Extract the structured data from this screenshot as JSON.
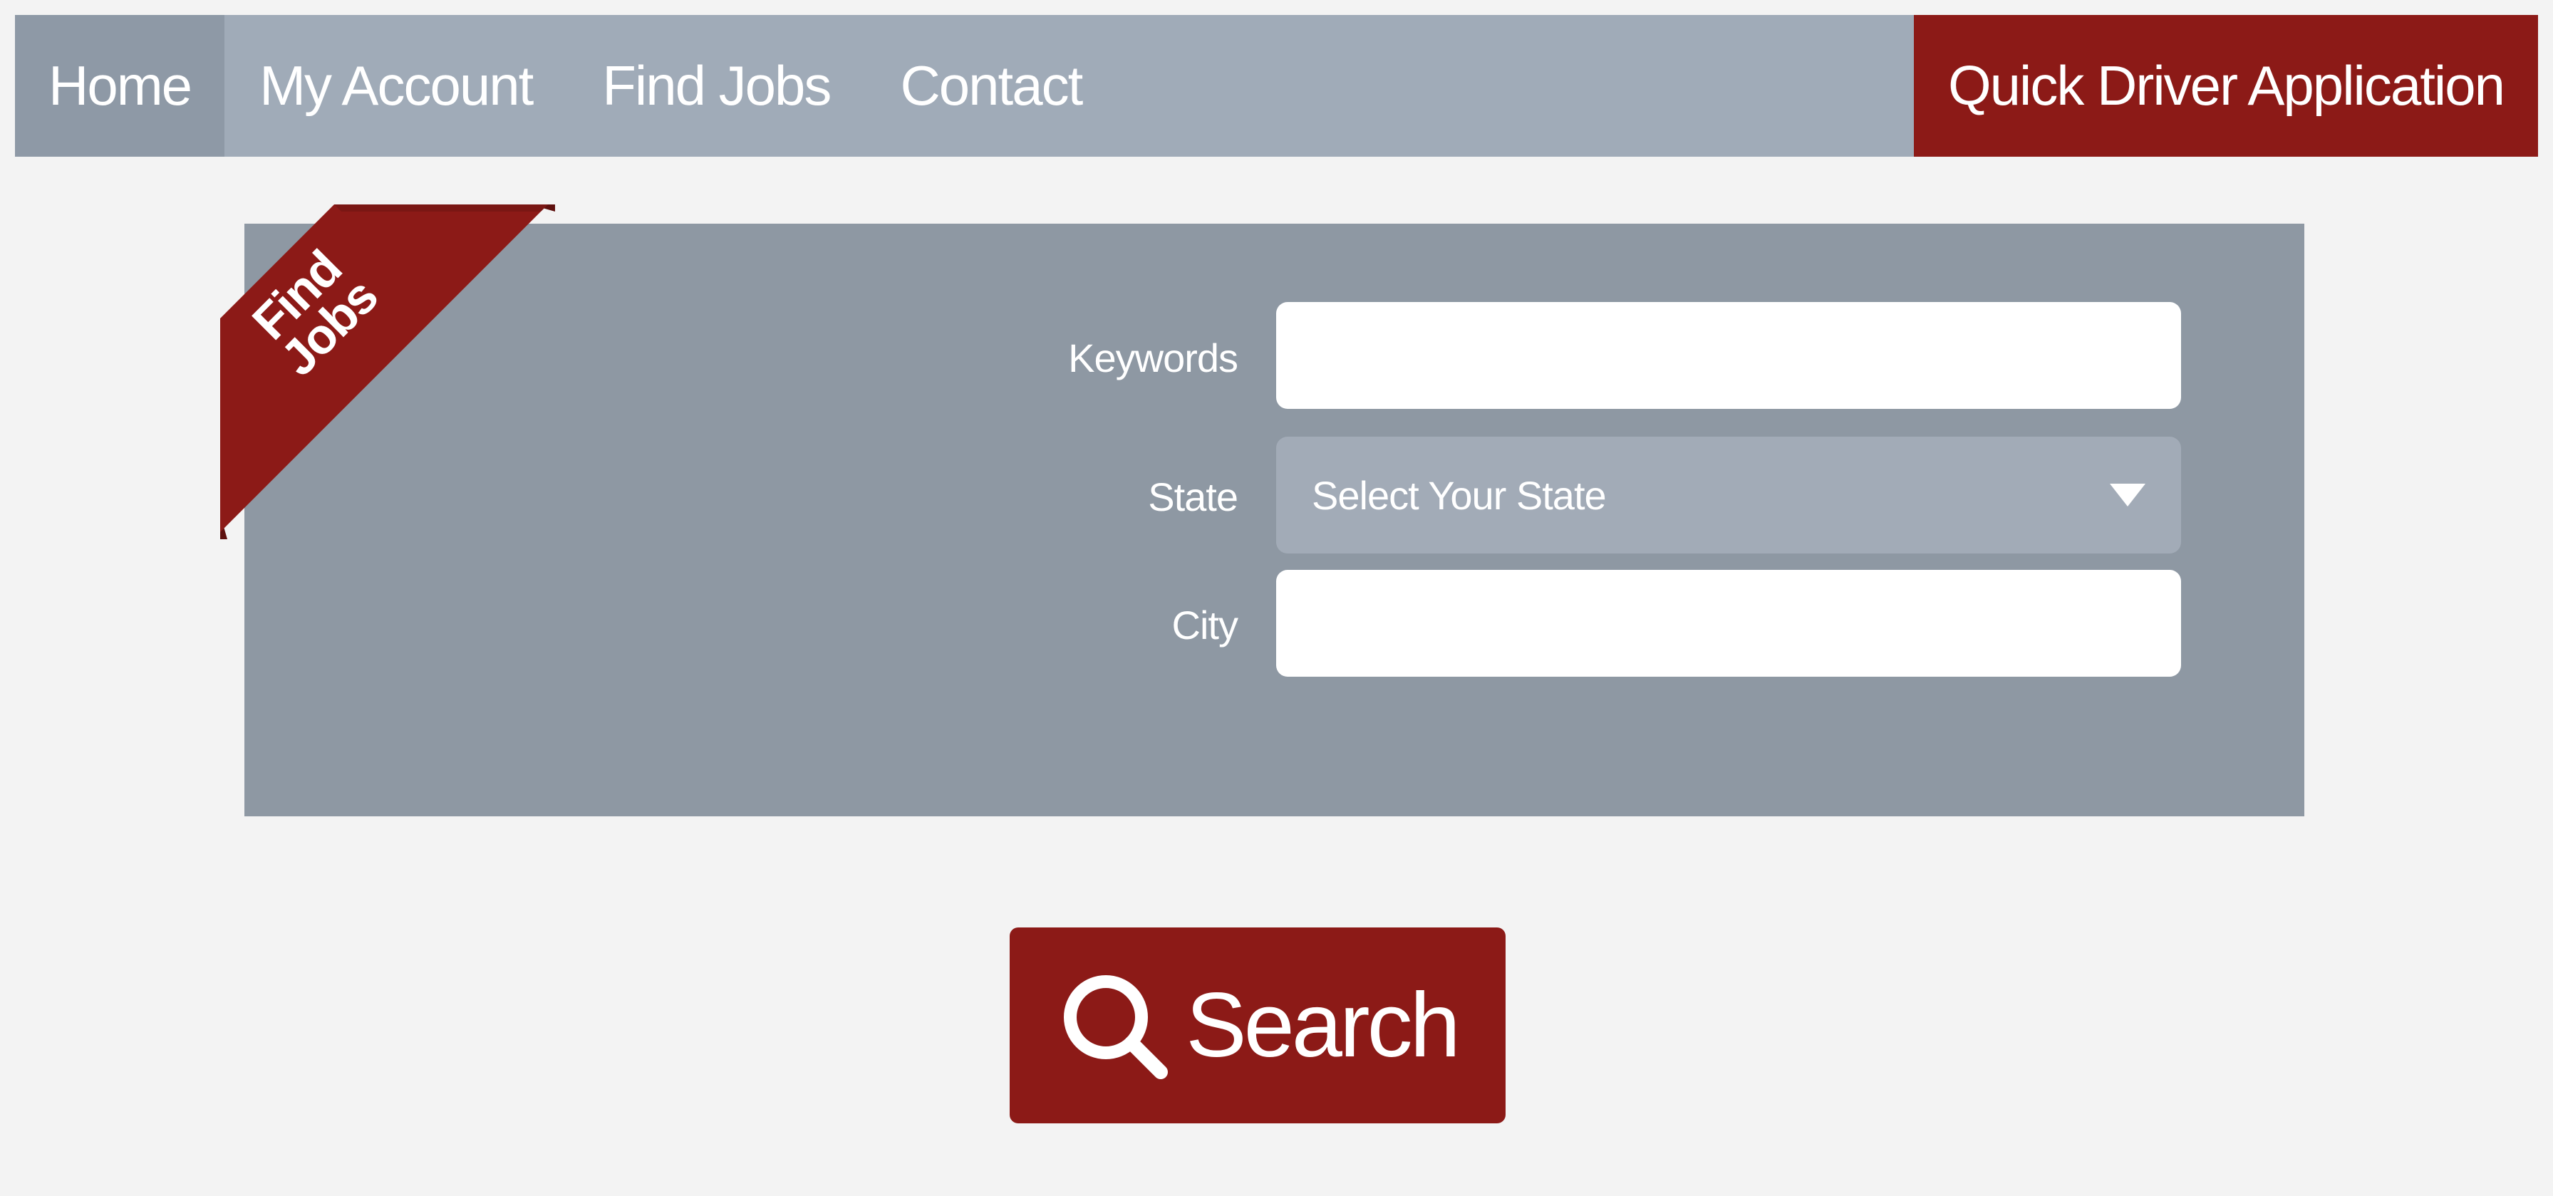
{
  "nav": {
    "items": [
      {
        "label": "Home",
        "active": true
      },
      {
        "label": "My Account",
        "active": false
      },
      {
        "label": "Find Jobs",
        "active": false
      },
      {
        "label": "Contact",
        "active": false
      }
    ],
    "cta_label": "Quick Driver Application"
  },
  "ribbon": {
    "line1": "Find",
    "line2": "Jobs"
  },
  "form": {
    "keywords": {
      "label": "Keywords",
      "value": ""
    },
    "state": {
      "label": "State",
      "selected": "Select Your State"
    },
    "city": {
      "label": "City",
      "value": ""
    }
  },
  "search_button": {
    "label": "Search",
    "icon": "search-icon"
  },
  "colors": {
    "accent": "#8c1a17",
    "nav_bg": "#a0abb8",
    "nav_active_bg": "#8e99a6",
    "panel_bg": "#8e98a3",
    "page_bg": "#f3f3f3"
  }
}
